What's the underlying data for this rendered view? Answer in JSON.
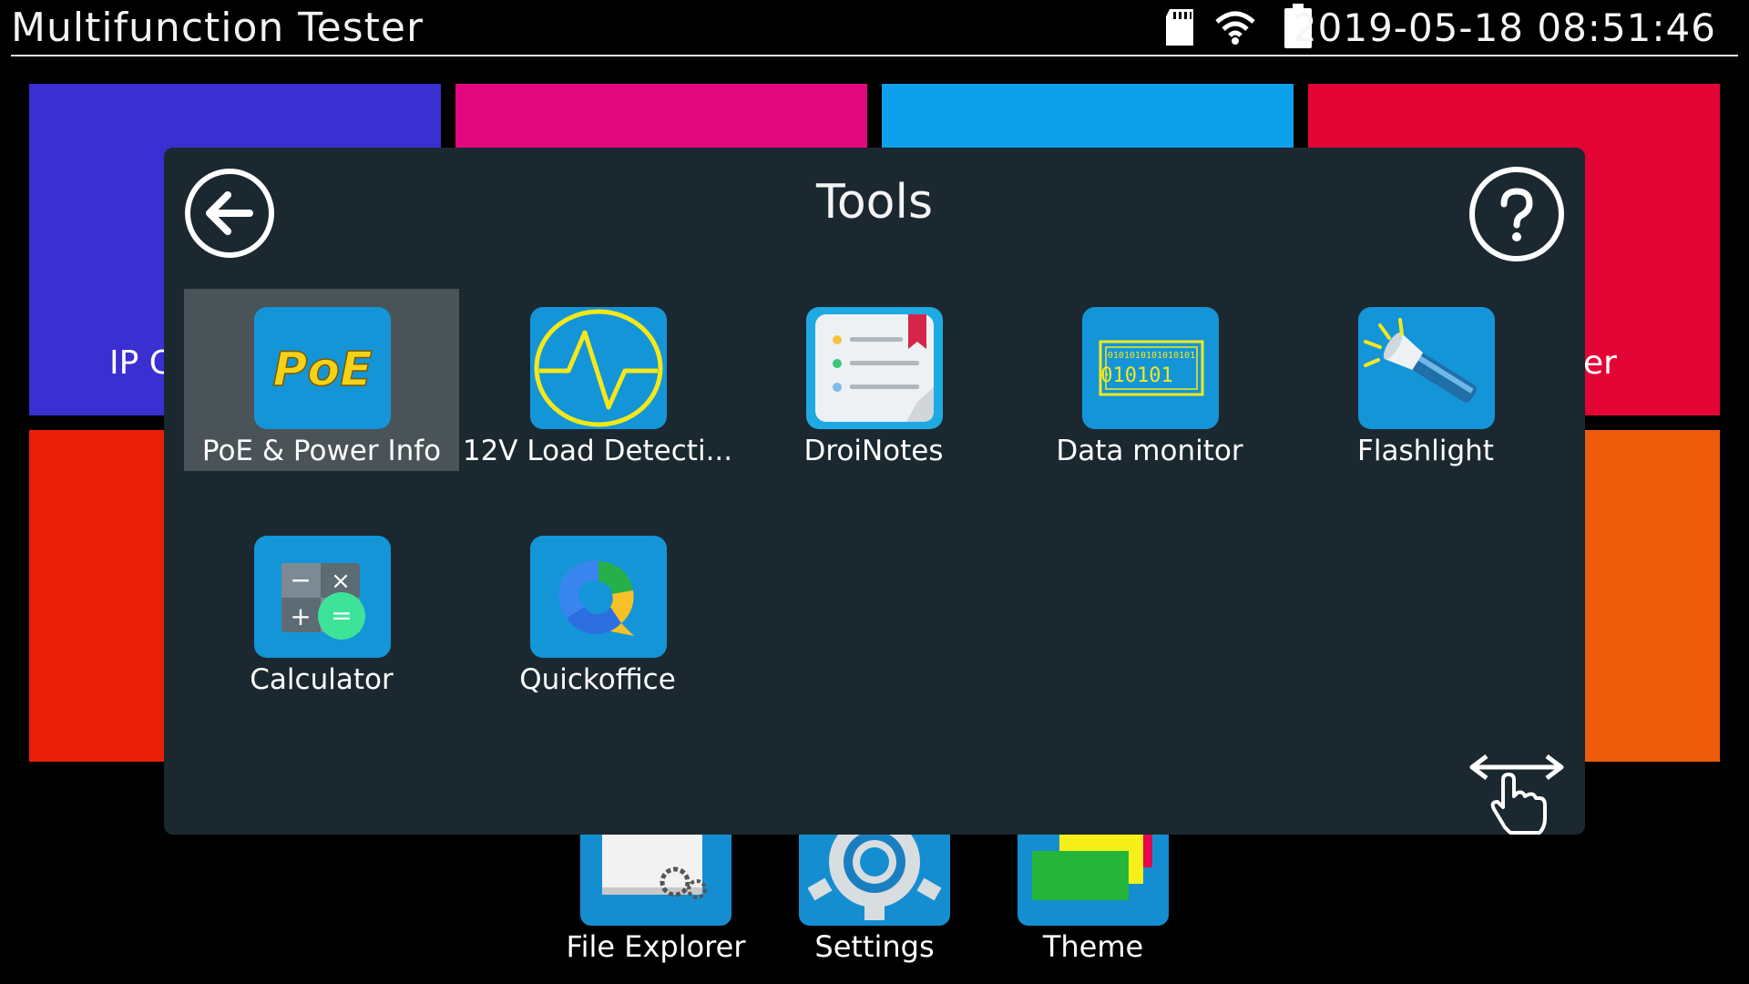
{
  "status_bar": {
    "app_title": "Multifunction Tester",
    "datetime": "2019-05-18 08:51:46",
    "icons": [
      "sd-card-icon",
      "wifi-icon",
      "battery-icon"
    ]
  },
  "background_tiles": [
    {
      "name": "ip-tile",
      "label": "IP C",
      "color": "#3a2fd0"
    },
    {
      "name": "pink-tile",
      "label": "",
      "color": "#e4087f"
    },
    {
      "name": "cyan-tile",
      "label": "",
      "color": "#0fa0ec"
    },
    {
      "name": "red-tile",
      "label": "er",
      "color": "#e40335"
    },
    {
      "name": "orange-red-tile",
      "label": "",
      "color": "#e92007"
    },
    {
      "name": "orange-tile",
      "label": "",
      "color": "#ec5c0a"
    }
  ],
  "dock": [
    {
      "label": "File Explorer",
      "icon": "file-explorer-icon"
    },
    {
      "label": "Settings",
      "icon": "gear-icon"
    },
    {
      "label": "Theme",
      "icon": "theme-icon"
    }
  ],
  "modal": {
    "title": "Tools",
    "back_icon": "back-arrow-icon",
    "help_icon": "help-icon",
    "swipe_icon": "swipe-hand-icon",
    "apps": [
      {
        "label": "PoE & Power Info",
        "icon": "poe-icon",
        "selected": true,
        "icon_text": "PoE"
      },
      {
        "label": "12V Load Detecti...",
        "icon": "load-detection-icon",
        "selected": false
      },
      {
        "label": "DroiNotes",
        "icon": "notes-icon",
        "selected": false
      },
      {
        "label": "Data monitor",
        "icon": "data-monitor-icon",
        "selected": false,
        "icon_text_top": "0101010101010101",
        "icon_text_main": "010101"
      },
      {
        "label": "Flashlight",
        "icon": "flashlight-icon",
        "selected": false
      },
      {
        "label": "Calculator",
        "icon": "calculator-icon",
        "selected": false,
        "icon_symbols": [
          "−",
          "×",
          "+",
          "="
        ]
      },
      {
        "label": "Quickoffice",
        "icon": "quickoffice-icon",
        "selected": false
      }
    ]
  },
  "colors": {
    "modal_bg": "#1b2830",
    "app_icon_bg": "#1495d8",
    "selected_bg": "#4a5358"
  }
}
